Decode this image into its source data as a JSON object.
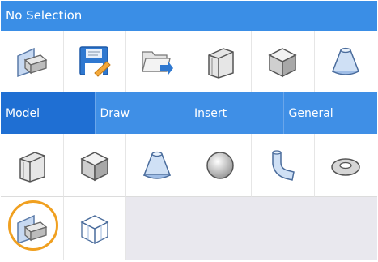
{
  "title": "No Selection",
  "tabs": [
    {
      "label": "Model",
      "active": true
    },
    {
      "label": "Draw",
      "active": false
    },
    {
      "label": "Insert",
      "active": false
    },
    {
      "label": "General",
      "active": false
    }
  ],
  "top_tools": [
    {
      "icon": "section-plane-icon"
    },
    {
      "icon": "save-file-icon"
    },
    {
      "icon": "open-folder-icon"
    },
    {
      "icon": "wall-icon"
    },
    {
      "icon": "box-icon"
    },
    {
      "icon": "frustum-icon"
    }
  ],
  "model_tools": [
    {
      "icon": "wall-icon"
    },
    {
      "icon": "box-icon"
    },
    {
      "icon": "frustum-icon"
    },
    {
      "icon": "sphere-icon"
    },
    {
      "icon": "pipe-icon"
    },
    {
      "icon": "torus-icon"
    }
  ],
  "bottom_tools": [
    {
      "icon": "section-plane-icon",
      "highlighted": true
    },
    {
      "icon": "wireframe-box-icon",
      "highlighted": false
    }
  ],
  "colors": {
    "title_bar": "#3a8ee6",
    "tab_bar": "#3f8fe6",
    "active_tab": "#1f6fd3",
    "highlight": "#f0a020"
  }
}
